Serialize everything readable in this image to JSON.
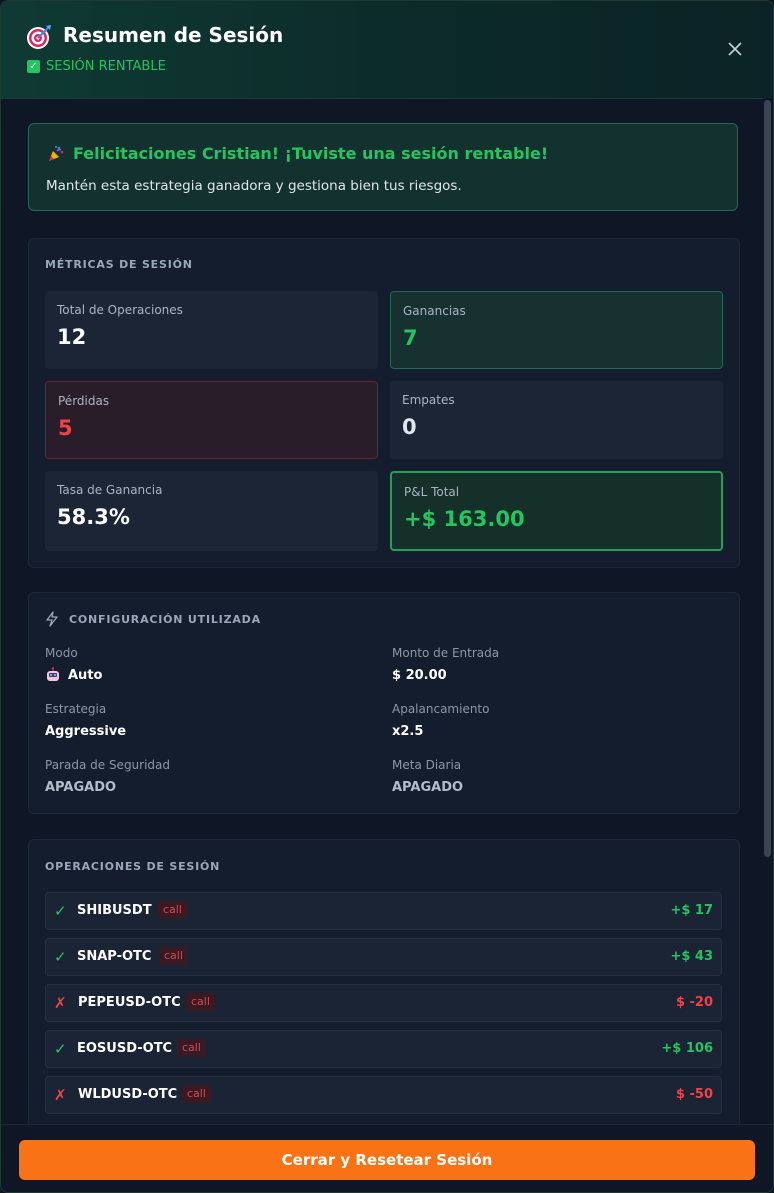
{
  "header": {
    "title": "Resumen de Sesión",
    "badge": "SESIÓN RENTABLE"
  },
  "banner": {
    "title": "Felicitaciones Cristian! ¡Tuviste una sesión rentable!",
    "subtitle": "Mantén esta estrategia ganadora y gestiona bien tus riesgos."
  },
  "metrics": {
    "title": "MÉTRICAS DE SESIÓN",
    "total_label": "Total de Operaciones",
    "total_value": "12",
    "wins_label": "Ganancias",
    "wins_value": "7",
    "losses_label": "Pérdidas",
    "losses_value": "5",
    "ties_label": "Empates",
    "ties_value": "0",
    "winrate_label": "Tasa de Ganancia",
    "winrate_value": "58.3%",
    "pnl_label": "P&L Total",
    "pnl_value": "+$ 163.00"
  },
  "config": {
    "title": "CONFIGURACIÓN UTILIZADA",
    "mode_label": "Modo",
    "mode_value": "Auto",
    "amount_label": "Monto de Entrada",
    "amount_value": "$ 20.00",
    "strategy_label": "Estrategia",
    "strategy_value": "Aggressive",
    "leverage_label": "Apalancamiento",
    "leverage_value": "x2.5",
    "stop_label": "Parada de Seguridad",
    "stop_value": "APAGADO",
    "goal_label": "Meta Diaria",
    "goal_value": "APAGADO"
  },
  "operations": {
    "title": "OPERACIONES DE SESIÓN",
    "items": [
      {
        "mark": "✓",
        "symbol": "SHIBUSDT",
        "direction": "call",
        "pnl": "+$ 17"
      },
      {
        "mark": "✓",
        "symbol": "SNAP-OTC",
        "direction": "call",
        "pnl": "+$ 43"
      },
      {
        "mark": "✗",
        "symbol": "PEPEUSD-OTC",
        "direction": "call",
        "pnl": "$ -20"
      },
      {
        "mark": "✓",
        "symbol": "EOSUSD-OTC",
        "direction": "call",
        "pnl": "+$ 106"
      },
      {
        "mark": "✗",
        "symbol": "WLDUSD-OTC",
        "direction": "call",
        "pnl": "$ -50"
      }
    ]
  },
  "footer": {
    "button_label": "Cerrar y Resetear Sesión"
  },
  "colors": {
    "accent_green": "#22c55e",
    "accent_red": "#ef4444",
    "accent_orange": "#f97316"
  },
  "icons": {
    "header": "target-dart-icon",
    "close": "close-icon",
    "banner": "party-popper-icon",
    "config": "lightning-icon",
    "mode": "robot-icon"
  }
}
